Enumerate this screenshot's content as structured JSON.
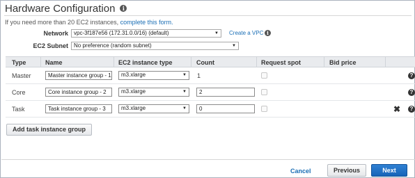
{
  "header": {
    "title": "Hardware Configuration",
    "note_text": "If you need more than 20 EC2 instances, ",
    "note_link": "complete this form."
  },
  "network": {
    "label": "Network",
    "value": "vpc-3f187e56 (172.31.0.0/16) (default)",
    "create_vpc_link": "Create a VPC"
  },
  "subnet": {
    "label": "EC2 Subnet",
    "value": "No preference (random subnet)"
  },
  "table": {
    "columns": [
      "Type",
      "Name",
      "EC2 instance type",
      "Count",
      "Request spot",
      "Bid price"
    ],
    "rows": [
      {
        "type": "Master",
        "name": "Master instance group - 1",
        "instance_type": "m3.xlarge",
        "count": "1"
      },
      {
        "type": "Core",
        "name": "Core instance group - 2",
        "instance_type": "m3.xlarge",
        "count": "2"
      },
      {
        "type": "Task",
        "name": "Task instance group - 3",
        "instance_type": "m3.xlarge",
        "count": "0"
      }
    ]
  },
  "actions": {
    "add_label": "Add task instance group",
    "cancel_label": "Cancel",
    "previous_label": "Previous",
    "next_label": "Next"
  },
  "icons": {
    "info": "info-icon",
    "help": "help-icon",
    "remove": "close-icon",
    "dropdown": "chevron-down-icon"
  },
  "colors": {
    "link": "#1a6eb5",
    "primary_button": "#1f71c6",
    "table_header": "#e9ebee"
  }
}
